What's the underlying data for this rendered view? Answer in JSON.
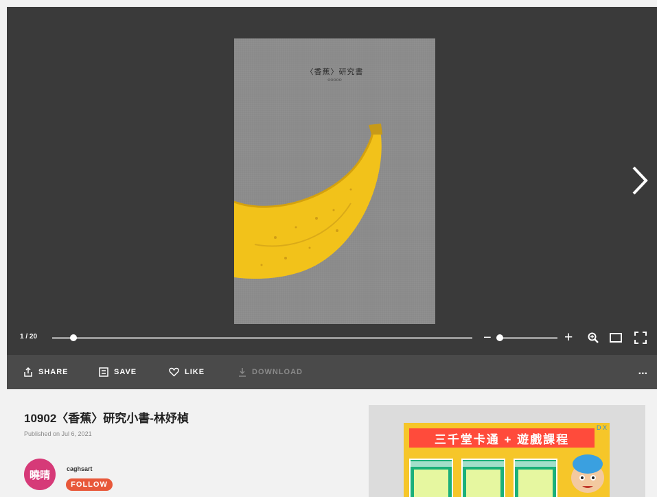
{
  "viewer": {
    "page_title": "〈香蕉〉研究書",
    "page_subtitle": "OOOOO",
    "page_indicator": "1 / 20",
    "page_progress": 0.05,
    "zoom_level": 0.05
  },
  "actions": {
    "share": "SHARE",
    "save": "SAVE",
    "like": "LIKE",
    "download": "DOWNLOAD",
    "more": "..."
  },
  "document": {
    "title": "10902〈香蕉〉研究小書-林妤楨",
    "published": "Published on Jul 6, 2021"
  },
  "author": {
    "avatar_text": "曉晴",
    "name": "caghsart",
    "follow_label": "FOLLOW"
  },
  "ad": {
    "headline": "三千堂卡通 + 遊戲課程",
    "close_label": "D X"
  },
  "colors": {
    "viewer_bg": "#3a3a3a",
    "actionbar_bg": "#4a4a4a",
    "follow": "#e8583a",
    "avatar": "#d63a78",
    "banana": "#f2c21a"
  },
  "icons": [
    "chevron-right-icon",
    "zoom-in-icon",
    "single-page-icon",
    "fullscreen-icon",
    "share-icon",
    "save-icon",
    "heart-icon",
    "download-icon"
  ]
}
